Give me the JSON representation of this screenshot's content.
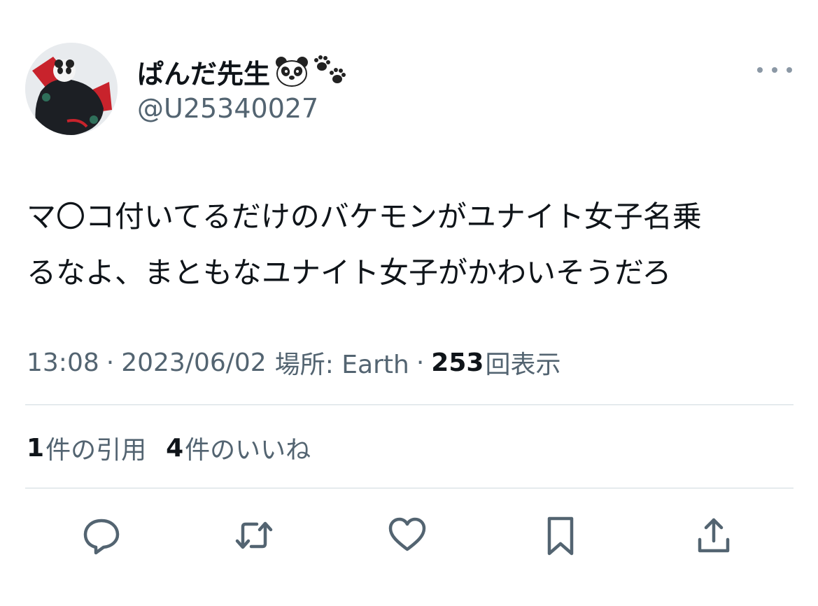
{
  "author": {
    "display_name": "ぱんだ先生",
    "name_emojis": [
      "panda-face-emoji",
      "paw-prints-emoji"
    ],
    "handle": "@U25340027"
  },
  "tweet": {
    "text_lines": [
      "マ〇コ付いてるだけのバケモンがユナイト女子名乗",
      "るなよ、まともなユナイト女子がかわいそうだろ"
    ]
  },
  "meta": {
    "time": "13:08",
    "separator": "·",
    "date": "2023/06/02",
    "location_label": "場所: Earth",
    "views_count": "253",
    "views_label": "回表示"
  },
  "stats": {
    "quotes_count": "1",
    "quotes_label": "件の引用",
    "likes_count": "4",
    "likes_label": "件のいいね"
  },
  "actions": [
    "reply-icon",
    "retweet-icon",
    "like-icon",
    "bookmark-icon",
    "share-icon"
  ],
  "colors": {
    "text": "#0f1419",
    "secondary": "#536471",
    "divider": "#cfd9de",
    "icon": "#536471",
    "avatar_accent": "#c8232c"
  }
}
